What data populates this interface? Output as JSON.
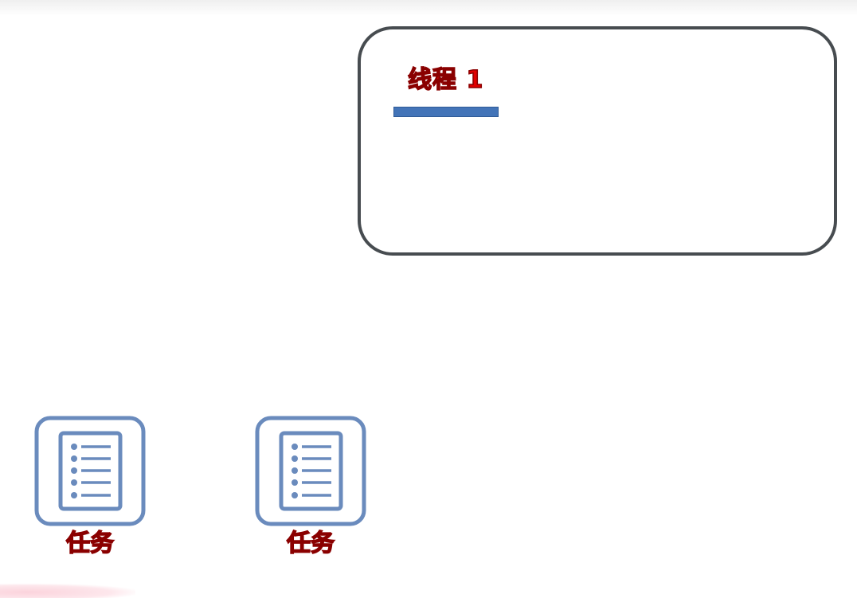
{
  "thread": {
    "title": "线程 1",
    "progress": 0.22,
    "border_color": "#474c50",
    "progress_color": "#4374b8"
  },
  "tasks": [
    {
      "label": "任务",
      "icon": "document-list-icon"
    },
    {
      "label": "任务",
      "icon": "document-list-icon"
    }
  ],
  "colors": {
    "label_red": "#e00000",
    "icon_blue": "#6a8bbd"
  }
}
